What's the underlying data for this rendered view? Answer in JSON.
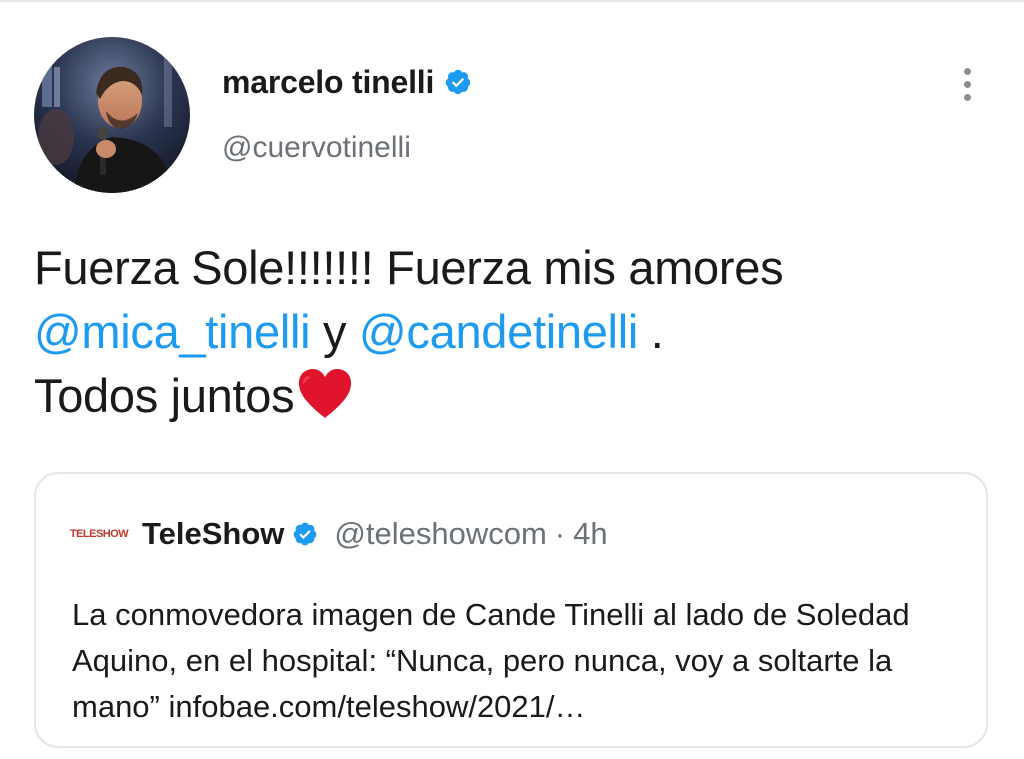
{
  "tweet": {
    "author": {
      "display_name": "marcelo tinelli",
      "handle": "@cuervotinelli",
      "verified_icon": "verified-badge-icon",
      "avatar_icon": "avatar-photo"
    },
    "text_parts": {
      "part1": "Fuerza Sole!!!!!!! Fuerza mis amores",
      "mention1": "@mica_tinelli",
      "part2": " y ",
      "mention2": "@candetinelli",
      "part3": " .",
      "part4": "Todos juntos"
    },
    "emoji": "red-heart",
    "more_icon": "more-vertical-icon"
  },
  "quoted_tweet": {
    "avatar_label": "TELESHOW",
    "display_name": "TeleShow",
    "handle": "@teleshowcom",
    "separator": "·",
    "time": "4h",
    "text": "La conmovedora imagen de Cande Tinelli al lado de Soledad Aquino, en el hospital: “Nunca, pero nunca, voy a soltarte la mano” infobae.com/teleshow/2021/…"
  },
  "colors": {
    "link": "#1d9bf0",
    "verified": "#1d9bf0",
    "secondary_text": "#6b7177",
    "card_border": "#e3e6e9",
    "heart": "#e0142c"
  }
}
